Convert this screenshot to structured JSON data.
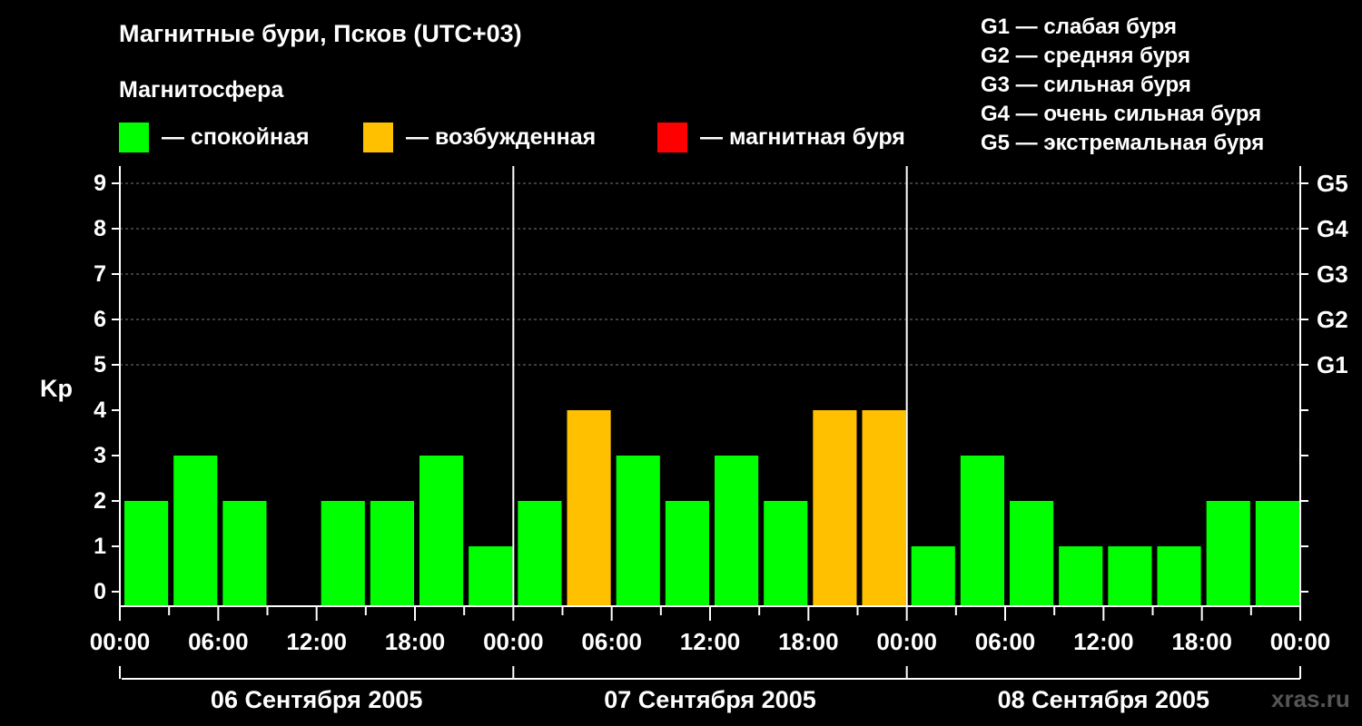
{
  "title": "Магнитные бури, Псков (UTC+03)",
  "subtitle": "Магнитосфера",
  "legend": [
    {
      "label": "— спокойная",
      "color": "#00ff00"
    },
    {
      "label": "— возбужденная",
      "color": "#ffc000"
    },
    {
      "label": "— магнитная буря",
      "color": "#ff0000"
    }
  ],
  "g_legend": [
    "G1 — слабая буря",
    "G2 — средняя буря",
    "G3 — сильная буря",
    "G4 — очень сильная буря",
    "G5 — экстремальная буря"
  ],
  "watermark": "xras.ru",
  "chart_data": {
    "type": "bar",
    "ylabel": "Kp",
    "ylim": [
      0,
      9
    ],
    "yticks": [
      "0",
      "1",
      "2",
      "3",
      "4",
      "5",
      "6",
      "7",
      "8",
      "9"
    ],
    "right_axis_labels": [
      {
        "kp": 5,
        "label": "G1"
      },
      {
        "kp": 6,
        "label": "G2"
      },
      {
        "kp": 7,
        "label": "G3"
      },
      {
        "kp": 8,
        "label": "G4"
      },
      {
        "kp": 9,
        "label": "G5"
      }
    ],
    "x_tick_labels": [
      "00:00",
      "06:00",
      "12:00",
      "18:00",
      "00:00",
      "06:00",
      "12:00",
      "18:00",
      "00:00",
      "06:00",
      "12:00",
      "18:00",
      "00:00"
    ],
    "days": [
      "06 Сентября 2005",
      "07 Сентября 2005",
      "08 Сентября 2005"
    ],
    "bar_interval_hours": 3,
    "values": [
      2,
      3,
      2,
      0,
      2,
      2,
      3,
      1,
      2,
      4,
      3,
      2,
      3,
      2,
      4,
      4,
      1,
      3,
      2,
      1,
      1,
      1,
      2,
      2
    ],
    "status": [
      "quiet",
      "quiet",
      "quiet",
      "quiet",
      "quiet",
      "quiet",
      "quiet",
      "quiet",
      "quiet",
      "excited",
      "quiet",
      "quiet",
      "quiet",
      "quiet",
      "excited",
      "excited",
      "quiet",
      "quiet",
      "quiet",
      "quiet",
      "quiet",
      "quiet",
      "quiet",
      "quiet"
    ],
    "colors": {
      "quiet": "#00ff00",
      "excited": "#ffc000",
      "storm": "#ff0000"
    },
    "grid": "dashed horizontal at each Kp level from 5 to 9"
  }
}
